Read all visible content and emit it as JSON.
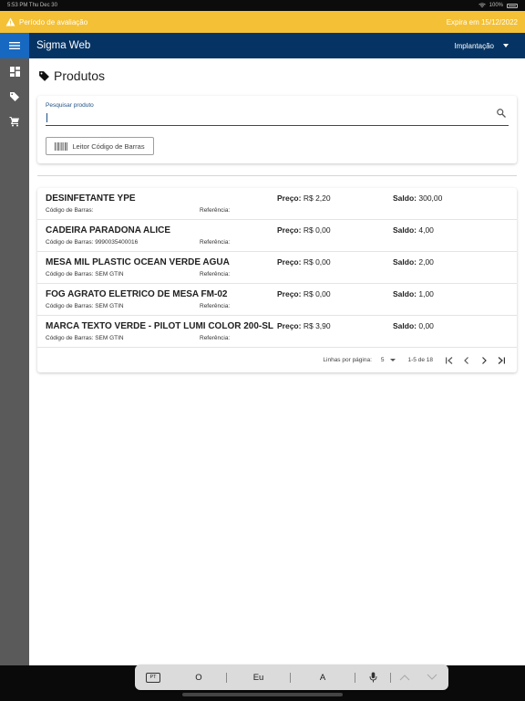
{
  "status_bar": {
    "time": "5:53 PM",
    "date": "Thu Dec 30",
    "battery": "100%"
  },
  "trial_banner": {
    "text": "Período de avaliação",
    "expires": "Expira em 15/12/2022",
    "warning_icon": "warning-icon",
    "color": "#f4c035"
  },
  "app_bar": {
    "title": "Sigma Web",
    "menu_icon": "menu-icon",
    "implantacao_label": "Implantação",
    "color": "#053464"
  },
  "side_rail": {
    "items": [
      {
        "icon": "dashboard-icon"
      },
      {
        "icon": "tag-icon"
      },
      {
        "icon": "cart-icon"
      }
    ]
  },
  "page": {
    "title": "Produtos",
    "title_icon": "tag-icon"
  },
  "search": {
    "label": "Pesquisar produto",
    "value": "",
    "icon": "search-icon",
    "barcode_button": "Leitor Código de Barras"
  },
  "labels": {
    "price": "Preço:",
    "saldo": "Saldo:",
    "code": "Código de Barras:",
    "ref": "Referência:"
  },
  "products": [
    {
      "name": "DESINFETANTE YPE",
      "price": "R$ 2,20",
      "saldo": "300,00",
      "barcode": "",
      "reference": ""
    },
    {
      "name": "CADEIRA PARADONA ALICE",
      "price": "R$ 0,00",
      "saldo": "4,00",
      "barcode": "9990035400016",
      "reference": ""
    },
    {
      "name": "MESA MIL PLASTIC OCEAN VERDE AGUA",
      "price": "R$ 0,00",
      "saldo": "2,00",
      "barcode": "SEM GTIN",
      "reference": ""
    },
    {
      "name": "FOG AGRATO ELETRICO DE MESA FM-02",
      "price": "R$ 0,00",
      "saldo": "1,00",
      "barcode": "SEM GTIN",
      "reference": ""
    },
    {
      "name": "MARCA TEXTO VERDE - PILOT LUMI COLOR 200-SL",
      "price": "R$ 3,90",
      "saldo": "0,00",
      "barcode": "SEM GTIN",
      "reference": ""
    }
  ],
  "pagination": {
    "rows_label": "Linhas por página:",
    "rows_value": "5",
    "range": "1-5 de 18"
  },
  "keyboard_bar": {
    "keyboard_icon": "keyboard-pt-icon",
    "keyboard_label": "PT",
    "suggestions": [
      "O",
      "Eu",
      "A"
    ],
    "mic_icon": "microphone-icon"
  }
}
